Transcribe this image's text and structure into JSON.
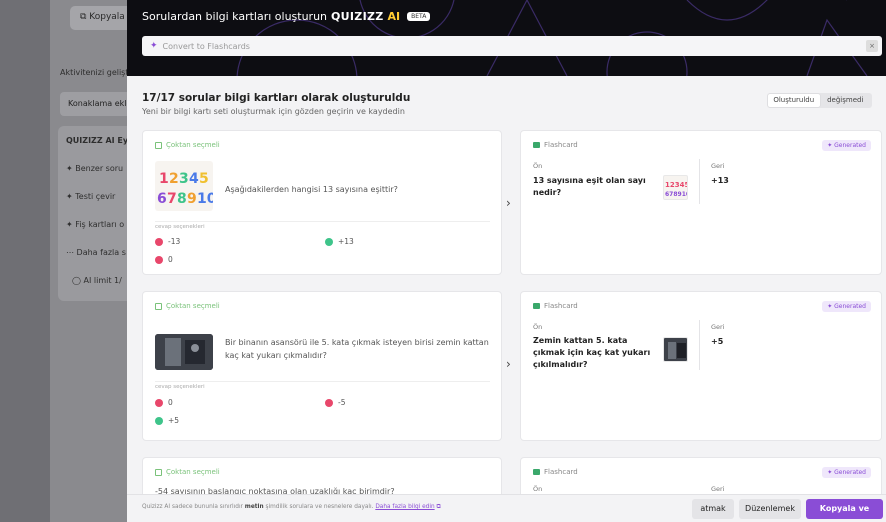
{
  "background": {
    "copy_button": "Kopyala",
    "section_label": "Aktivitenizi gelişti",
    "accommodation_button": "Konaklama ekle",
    "brand_text": "QUIZIZZ",
    "brand_ai": "AI",
    "brand_suffix": "Eyle",
    "items": [
      "Benzer soru",
      "Testi çevir",
      "Fiş kartları o",
      "Daha fazla s"
    ],
    "ai_limit": "AI limit 1/"
  },
  "modal": {
    "title": "Sorulardan bilgi kartları oluşturun",
    "brand": "QUIZIZZ",
    "brand_ai": "AI",
    "beta": "BETA",
    "convert_placeholder": "Convert to Flashcards",
    "summary_title": "17/17 sorular bilgi kartları olarak oluşturuldu",
    "summary_sub": "Yeni bir bilgi kartı seti oluşturmak için gözden geçirin ve kaydedin",
    "toggle": [
      "Oluşturuldu",
      "değişmedi"
    ]
  },
  "cards": [
    {
      "qtype": "Çoktan seçmeli",
      "question": "Aşağıdakilerden hangisi 13 sayısına eşittir?",
      "answers_label": "cevap seçenekleri",
      "answers": [
        {
          "text": "-13",
          "color": "#e8476b"
        },
        {
          "text": "+13",
          "color": "#3ec48a"
        },
        {
          "text": "0",
          "color": "#e8476b"
        }
      ],
      "fc_label": "Flashcard",
      "generated": "Generated",
      "front_label": "Ön",
      "back_label": "Geri",
      "front": "13 sayısına eşit olan sayı nedir?",
      "back": "+13"
    },
    {
      "qtype": "Çoktan seçmeli",
      "question": "Bir binanın asansörü ile 5. kata çıkmak isteyen birisi zemin kattan kaç kat yukarı çıkmalıdır?",
      "answers_label": "cevap seçenekleri",
      "answers": [
        {
          "text": "0",
          "color": "#e8476b"
        },
        {
          "text": "-5",
          "color": "#e8476b"
        },
        {
          "text": "+5",
          "color": "#3ec48a"
        }
      ],
      "fc_label": "Flashcard",
      "generated": "Generated",
      "front_label": "Ön",
      "back_label": "Geri",
      "front": "Zemin kattan 5. kata çıkmak için kaç kat yukarı çıkılmalıdır?",
      "back": "+5"
    },
    {
      "qtype": "Çoktan seçmeli",
      "question": "-54 sayısının başlangıç noktasına olan uzaklığı kaç birimdir?",
      "fc_label": "Flashcard",
      "generated": "Generated",
      "front_label": "Ön",
      "back_label": "Geri"
    }
  ],
  "footer": {
    "note_prefix": "Quizizz AI sadece bununla sınırlıdır",
    "note_bold": "metin",
    "note_suffix": "şimdilik sorulara ve nesnelere dayalı.",
    "learn_more": "Daha fazla bilgi edin",
    "skip": "atmak",
    "edit": "Düzenlemek",
    "save": "Kopyala ve kaydet"
  },
  "colors": {
    "accent": "#8a4dd6",
    "correct": "#3ec48a",
    "wrong": "#e8476b",
    "header_bg": "#0d0d12"
  }
}
